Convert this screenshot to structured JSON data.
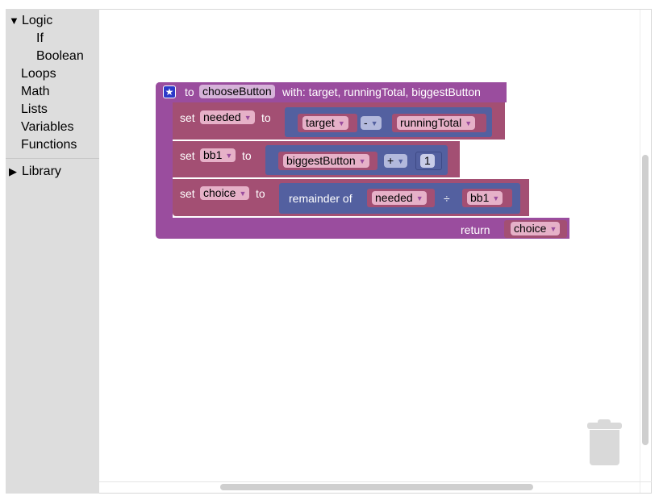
{
  "toolbox": {
    "logic": "Logic",
    "if": "If",
    "boolean": "Boolean",
    "loops": "Loops",
    "math": "Math",
    "lists": "Lists",
    "variables": "Variables",
    "functions": "Functions",
    "library": "Library",
    "expanded_arrow": "▼",
    "collapsed_arrow": "▶"
  },
  "procedure": {
    "to": "to",
    "name": "chooseButton",
    "with": "with: target, runningTotal, biggestButton",
    "return_label": "return",
    "return_value": "choice"
  },
  "statements": [
    {
      "set": "set",
      "var": "needed",
      "to": "to",
      "left": "target",
      "op": "-",
      "right": "runningTotal"
    },
    {
      "set": "set",
      "var": "bb1",
      "to": "to",
      "left": "biggestButton",
      "op": "+",
      "right": "1"
    },
    {
      "set": "set",
      "var": "choice",
      "to": "to",
      "func": "remainder of",
      "left": "needed",
      "op": "÷",
      "right": "bb1"
    }
  ],
  "icons": {
    "procedure": "star-icon",
    "trash": "trash-icon",
    "dropdown": "chevron-down-icon"
  },
  "colors": {
    "procedure_block": "#9a4d9e",
    "variable_block": "#a34f73",
    "math_block": "#5360a0",
    "toolbox_bg": "#dddddd"
  }
}
